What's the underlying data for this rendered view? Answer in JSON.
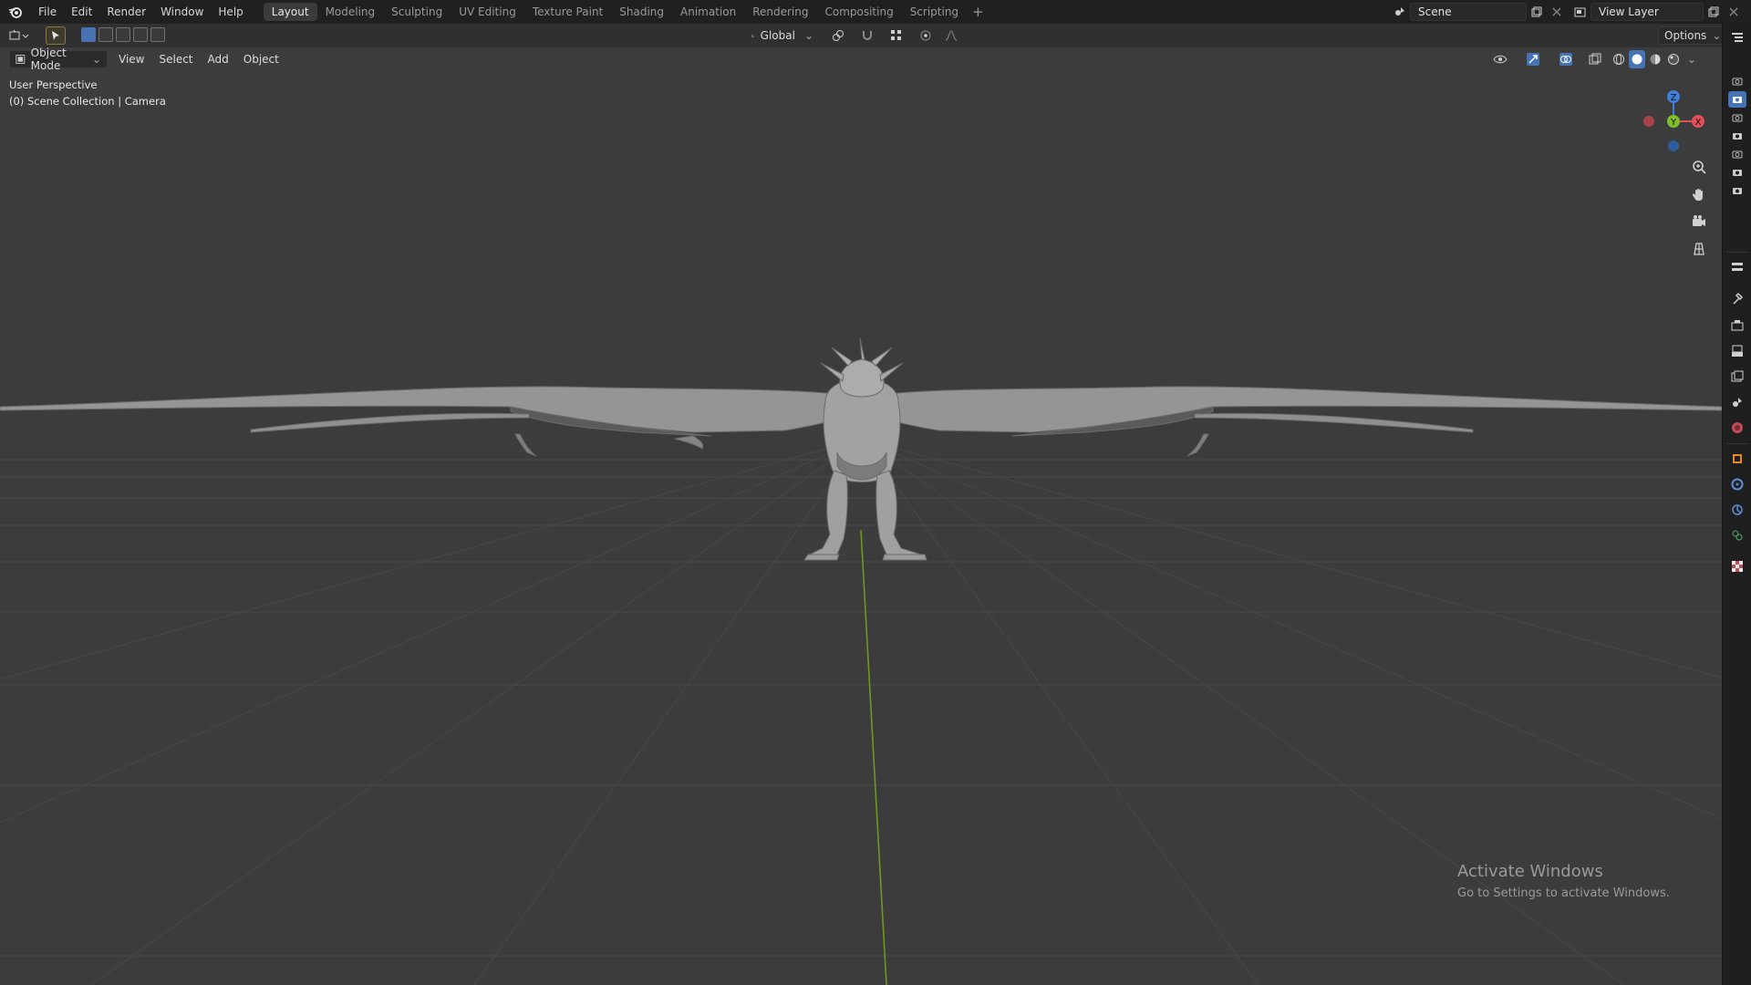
{
  "menu": {
    "items": [
      "File",
      "Edit",
      "Render",
      "Window",
      "Help"
    ]
  },
  "workspaces": {
    "tabs": [
      "Layout",
      "Modeling",
      "Sculpting",
      "UV Editing",
      "Texture Paint",
      "Shading",
      "Animation",
      "Rendering",
      "Compositing",
      "Scripting"
    ],
    "active": "Layout",
    "add_label": "+"
  },
  "scene": {
    "name": "Scene"
  },
  "view_layer": {
    "name": "View Layer"
  },
  "toolbar": {
    "transform_orientation": "Global",
    "options_label": "Options"
  },
  "viewport_header": {
    "mode": "Object Mode",
    "menus": [
      "View",
      "Select",
      "Add",
      "Object"
    ]
  },
  "viewport": {
    "perspective_label": "User Perspective",
    "collection_label": "(0) Scene Collection | Camera"
  },
  "gizmo": {
    "z": "Z",
    "y": "Y",
    "x": "X"
  },
  "watermark": {
    "title": "Activate Windows",
    "subtitle": "Go to Settings to activate Windows."
  },
  "colors": {
    "x_axis": "#e0505a",
    "y_axis": "#7fbf2f",
    "z_axis": "#3d7fd9",
    "accent": "#4772b3"
  }
}
